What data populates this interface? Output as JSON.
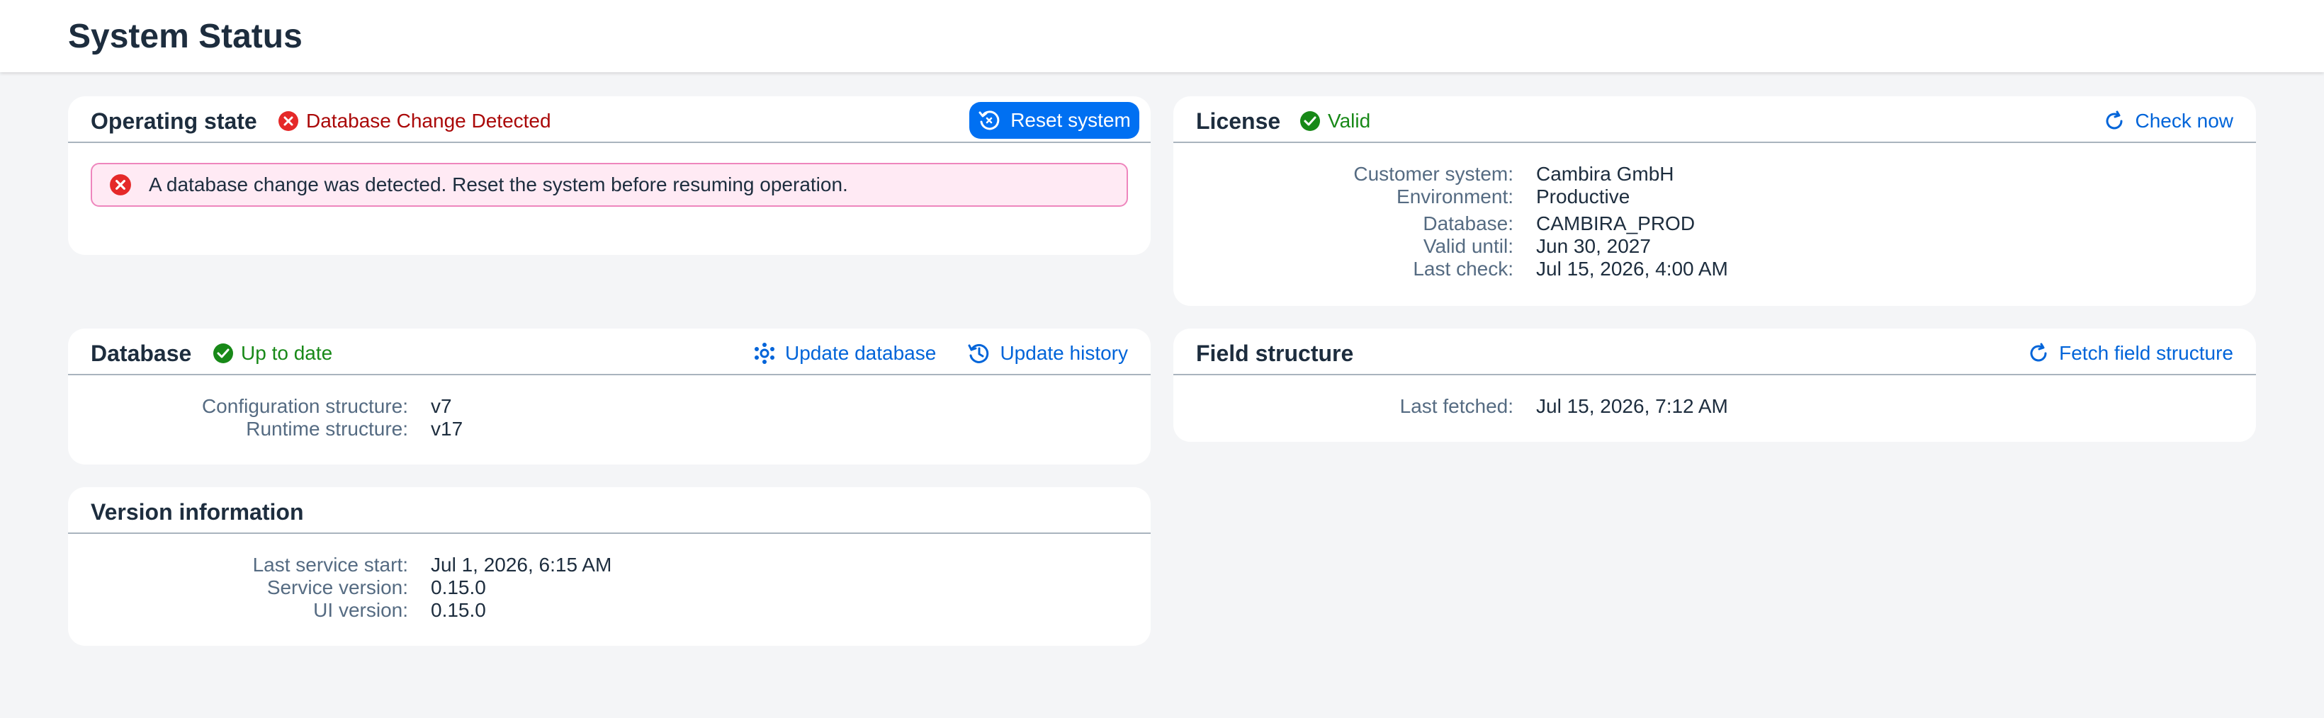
{
  "page": {
    "title": "System Status"
  },
  "operating_state": {
    "title": "Operating state",
    "status": "Database Change Detected",
    "reset_label": "Reset system",
    "alert": "A database change was detected. Reset the system before resuming operation."
  },
  "license": {
    "title": "License",
    "status": "Valid",
    "check_label": "Check now",
    "fields": [
      {
        "label": "Customer system:",
        "value": "Cambira GmbH"
      },
      {
        "label": "Environment:",
        "value": "Productive"
      },
      {
        "label": "Database:",
        "value": "CAMBIRA_PROD"
      },
      {
        "label": "Valid until:",
        "value": "Jun 30, 2027"
      },
      {
        "label": "Last check:",
        "value": "Jul 15, 2026, 4:00 AM"
      }
    ]
  },
  "database": {
    "title": "Database",
    "status": "Up to date",
    "update_label": "Update database",
    "history_label": "Update history",
    "fields": [
      {
        "label": "Configuration structure:",
        "value": "v7"
      },
      {
        "label": "Runtime structure:",
        "value": "v17"
      }
    ]
  },
  "field_structure": {
    "title": "Field structure",
    "fetch_label": "Fetch field structure",
    "fields": [
      {
        "label": "Last fetched:",
        "value": "Jul 15, 2026, 7:12 AM"
      }
    ]
  },
  "version": {
    "title": "Version information",
    "fields": [
      {
        "label": "Last service start:",
        "value": "Jul 1, 2026, 6:15 AM"
      },
      {
        "label": "Service version:",
        "value": "0.15.0"
      },
      {
        "label": "UI version:",
        "value": "0.15.0"
      }
    ]
  },
  "colors": {
    "primary": "#0070f2",
    "link": "#0064d9",
    "error": "#aa0808",
    "success": "#188918",
    "alert_bg": "#ffeaf4"
  },
  "icons": {
    "error": "error-circle-icon",
    "success": "check-circle-icon",
    "reset": "reset-icon",
    "refresh": "refresh-icon",
    "update": "update-database-icon",
    "history": "history-icon"
  }
}
